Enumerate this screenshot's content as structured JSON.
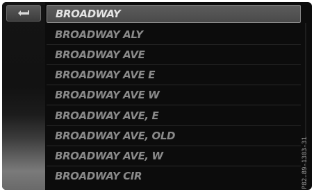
{
  "sidebar": {
    "back_button_icon": "back-arrow-icon"
  },
  "list": {
    "items": [
      {
        "label": "BROADWAY",
        "selected": true
      },
      {
        "label": "BROADWAY ALY",
        "selected": false
      },
      {
        "label": "BROADWAY AVE",
        "selected": false
      },
      {
        "label": "BROADWAY AVE E",
        "selected": false
      },
      {
        "label": "BROADWAY AVE W",
        "selected": false
      },
      {
        "label": "BROADWAY AVE, E",
        "selected": false
      },
      {
        "label": "BROADWAY AVE, OLD",
        "selected": false
      },
      {
        "label": "BROADWAY AVE, W",
        "selected": false
      },
      {
        "label": "BROADWAY CIR",
        "selected": false
      }
    ]
  },
  "image_code": "P82.89-1303-31",
  "colors": {
    "screen_background": "#0c0c0c",
    "selected_text": "#e4e4e4",
    "item_text": "#8a8a8a"
  }
}
